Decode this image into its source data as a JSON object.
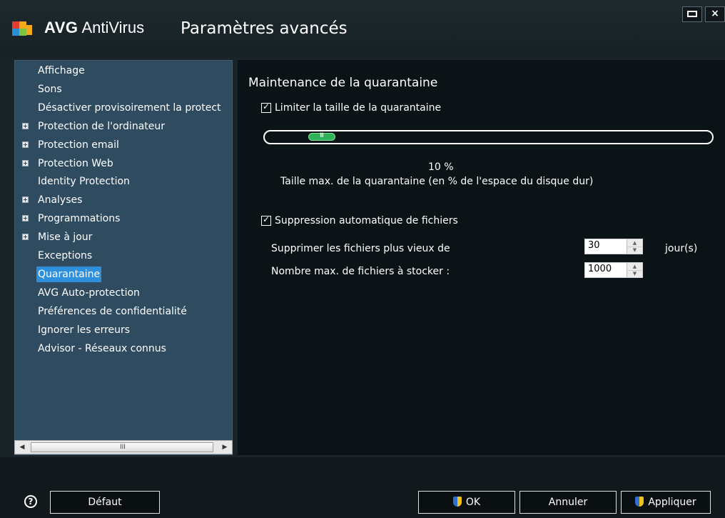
{
  "window": {
    "app_name_bold": "AVG",
    "app_name_rest": " AntiVirus",
    "title": "Paramètres avancés",
    "close_glyph": "×"
  },
  "tree": {
    "items": [
      {
        "label": "Affichage",
        "expandable": false
      },
      {
        "label": "Sons",
        "expandable": false
      },
      {
        "label": "Désactiver provisoirement la protect",
        "expandable": false
      },
      {
        "label": "Protection de l'ordinateur",
        "expandable": true
      },
      {
        "label": "Protection email",
        "expandable": true
      },
      {
        "label": "Protection Web",
        "expandable": true
      },
      {
        "label": "Identity Protection",
        "expandable": false
      },
      {
        "label": "Analyses",
        "expandable": true
      },
      {
        "label": "Programmations",
        "expandable": true
      },
      {
        "label": "Mise à jour",
        "expandable": true
      },
      {
        "label": "Exceptions",
        "expandable": false
      },
      {
        "label": "Quarantaine",
        "expandable": false,
        "selected": true
      },
      {
        "label": "AVG Auto-protection",
        "expandable": false
      },
      {
        "label": "Préférences de confidentialité",
        "expandable": false
      },
      {
        "label": "Ignorer les erreurs",
        "expandable": false
      },
      {
        "label": "Advisor - Réseaux connus",
        "expandable": false
      }
    ],
    "scroll_left": "◀",
    "scroll_right": "▶",
    "scroll_grip": "III"
  },
  "panel": {
    "section_title": "Maintenance de la quarantaine",
    "limit_size": {
      "label": "Limiter la taille de la quarantaine",
      "checked": true
    },
    "slider": {
      "value_percent": 10,
      "percent_label": "10 %",
      "caption": "Taille max. de la quarantaine (en % de l'espace du disque dur)",
      "grip": "III"
    },
    "auto_delete": {
      "label": "Suppression automatique de fichiers",
      "checked": true
    },
    "max_age": {
      "label": "Supprimer les fichiers plus vieux de",
      "value": "30",
      "unit": "jour(s)"
    },
    "max_files": {
      "label": "Nombre max. de fichiers à stocker :",
      "value": "1000"
    }
  },
  "footer": {
    "help_glyph": "?",
    "default_label": "Défaut",
    "ok_label": "OK",
    "cancel_label": "Annuler",
    "apply_label": "Appliquer"
  },
  "colors": {
    "tree_bg": "#2f4b60",
    "selection": "#2e8fdc",
    "slider_handle": "#2fb157",
    "panel_bg": "#0b1316"
  }
}
